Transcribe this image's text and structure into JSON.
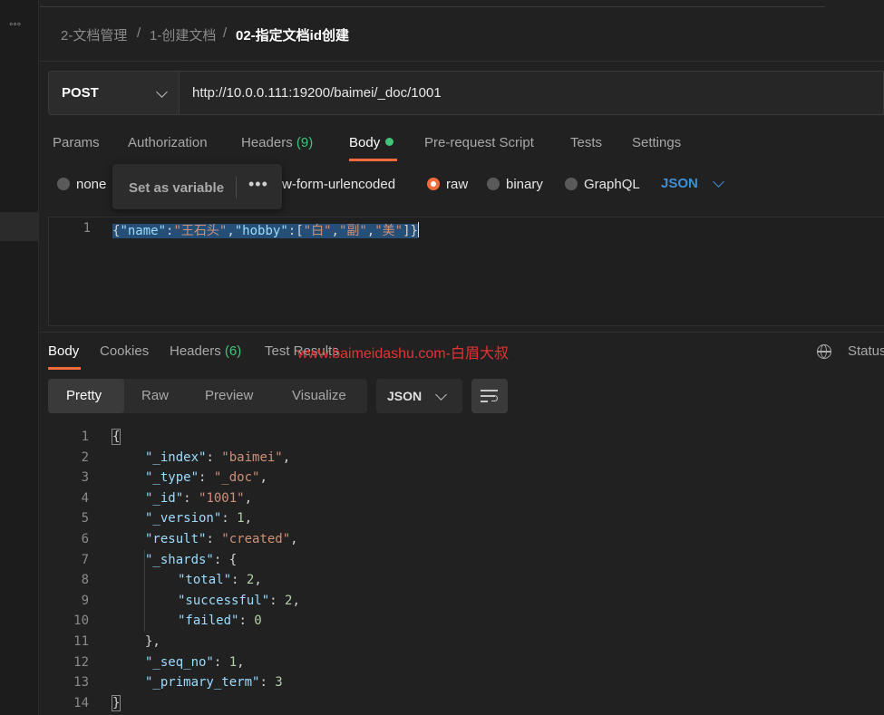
{
  "sidebar": {
    "more_icon": "more-horizontal-icon",
    "more_glyph": "°°°"
  },
  "breadcrumb": {
    "items": [
      "2-文档管理",
      "1-创建文档",
      "02-指定文档id创建"
    ],
    "separator": "/"
  },
  "request": {
    "method": "POST",
    "url": "http://10.0.0.111:19200/baimei/_doc/1001"
  },
  "request_tabs": {
    "params": "Params",
    "authorization": "Authorization",
    "headers": "Headers",
    "headers_count": "(9)",
    "body": "Body",
    "pre_request": "Pre-request Script",
    "tests": "Tests",
    "settings": "Settings"
  },
  "body_types": {
    "none": "none",
    "urlencoded": "w-form-urlencoded",
    "raw": "raw",
    "binary": "binary",
    "graphql": "GraphQL",
    "language": "JSON",
    "selected": "raw"
  },
  "tooltip": {
    "label": "Set as variable",
    "more": "•••"
  },
  "editor": {
    "line_number": "1",
    "content": "{\"name\":\"王石头\",\"hobby\":[\"白\",\"副\",\"美\"]}"
  },
  "response_tabs": {
    "body": "Body",
    "cookies": "Cookies",
    "headers": "Headers",
    "headers_count": "(6)",
    "test_results": "Test Results",
    "status": "Status"
  },
  "watermark": "www.baimeidashu.com-白眉大叔",
  "view_modes": [
    "Pretty",
    "Raw",
    "Preview",
    "Visualize"
  ],
  "format": "JSON",
  "response_lines": [
    {
      "n": "1",
      "indent": 0,
      "parts": [
        [
          "p",
          "{"
        ]
      ],
      "box": true
    },
    {
      "n": "2",
      "indent": 1,
      "parts": [
        [
          "k",
          "\"_index\""
        ],
        [
          "p",
          ": "
        ],
        [
          "s",
          "\"baimei\""
        ],
        [
          "p",
          ","
        ]
      ]
    },
    {
      "n": "3",
      "indent": 1,
      "parts": [
        [
          "k",
          "\"_type\""
        ],
        [
          "p",
          ": "
        ],
        [
          "s",
          "\"_doc\""
        ],
        [
          "p",
          ","
        ]
      ]
    },
    {
      "n": "4",
      "indent": 1,
      "parts": [
        [
          "k",
          "\"_id\""
        ],
        [
          "p",
          ": "
        ],
        [
          "s",
          "\"1001\""
        ],
        [
          "p",
          ","
        ]
      ]
    },
    {
      "n": "5",
      "indent": 1,
      "parts": [
        [
          "k",
          "\"_version\""
        ],
        [
          "p",
          ": "
        ],
        [
          "n",
          "1"
        ],
        [
          "p",
          ","
        ]
      ]
    },
    {
      "n": "6",
      "indent": 1,
      "parts": [
        [
          "k",
          "\"result\""
        ],
        [
          "p",
          ": "
        ],
        [
          "s",
          "\"created\""
        ],
        [
          "p",
          ","
        ]
      ]
    },
    {
      "n": "7",
      "indent": 1,
      "parts": [
        [
          "k",
          "\"_shards\""
        ],
        [
          "p",
          ": {"
        ]
      ]
    },
    {
      "n": "8",
      "indent": 2,
      "parts": [
        [
          "k",
          "\"total\""
        ],
        [
          "p",
          ": "
        ],
        [
          "n",
          "2"
        ],
        [
          "p",
          ","
        ]
      ]
    },
    {
      "n": "9",
      "indent": 2,
      "parts": [
        [
          "k",
          "\"successful\""
        ],
        [
          "p",
          ": "
        ],
        [
          "n",
          "2"
        ],
        [
          "p",
          ","
        ]
      ]
    },
    {
      "n": "10",
      "indent": 2,
      "parts": [
        [
          "k",
          "\"failed\""
        ],
        [
          "p",
          ": "
        ],
        [
          "n",
          "0"
        ]
      ]
    },
    {
      "n": "11",
      "indent": 1,
      "parts": [
        [
          "p",
          "},"
        ]
      ]
    },
    {
      "n": "12",
      "indent": 1,
      "parts": [
        [
          "k",
          "\"_seq_no\""
        ],
        [
          "p",
          ": "
        ],
        [
          "n",
          "1"
        ],
        [
          "p",
          ","
        ]
      ]
    },
    {
      "n": "13",
      "indent": 1,
      "parts": [
        [
          "k",
          "\"_primary_term\""
        ],
        [
          "p",
          ": "
        ],
        [
          "n",
          "3"
        ]
      ]
    },
    {
      "n": "14",
      "indent": 0,
      "parts": [
        [
          "p",
          "}"
        ]
      ],
      "box": true
    }
  ]
}
